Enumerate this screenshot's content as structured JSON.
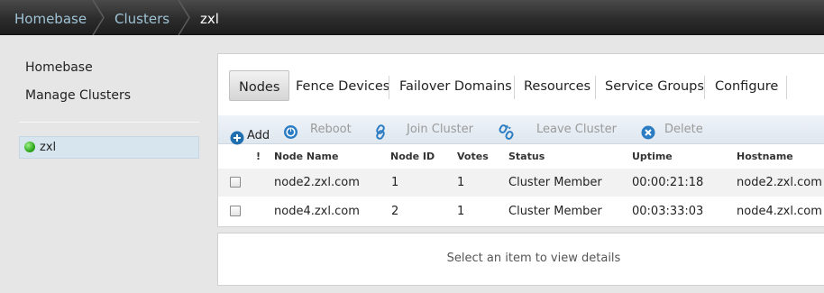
{
  "breadcrumb": {
    "items": [
      "Homebase",
      "Clusters"
    ],
    "current": "zxl"
  },
  "sidebar": {
    "links": [
      "Homebase",
      "Manage Clusters"
    ],
    "cluster": {
      "name": "zxl",
      "status_color": "#2ea81d"
    }
  },
  "tabs": {
    "items": [
      "Nodes",
      "Fence Devices",
      "Failover Domains",
      "Resources",
      "Service Groups",
      "Configure"
    ],
    "active": "Nodes"
  },
  "toolbar": {
    "add": {
      "label": "Add",
      "icon": "plus-circle-icon"
    },
    "reboot": {
      "label": "Reboot",
      "icon": "power-icon"
    },
    "join": {
      "label": "Join Cluster",
      "icon": "link-icon"
    },
    "leave": {
      "label": "Leave Cluster",
      "icon": "broken-link-icon"
    },
    "delete": {
      "label": "Delete",
      "icon": "x-circle-icon"
    }
  },
  "table": {
    "columns": [
      "!",
      "Node Name",
      "Node ID",
      "Votes",
      "Status",
      "Uptime",
      "Hostname"
    ],
    "rows": [
      {
        "node_name": "node2.zxl.com",
        "node_id": "1",
        "votes": "1",
        "status": "Cluster Member",
        "uptime": "00:00:21:18",
        "hostname": "node2.zxl.com"
      },
      {
        "node_name": "node4.zxl.com",
        "node_id": "2",
        "votes": "1",
        "status": "Cluster Member",
        "uptime": "00:03:33:03",
        "hostname": "node4.zxl.com"
      }
    ]
  },
  "details": {
    "message": "Select an item to view details"
  },
  "colors": {
    "accent_blue": "#1f6fb0",
    "breadcrumb_link": "#9fc3d6",
    "selected_bg": "#d7e5ef"
  }
}
